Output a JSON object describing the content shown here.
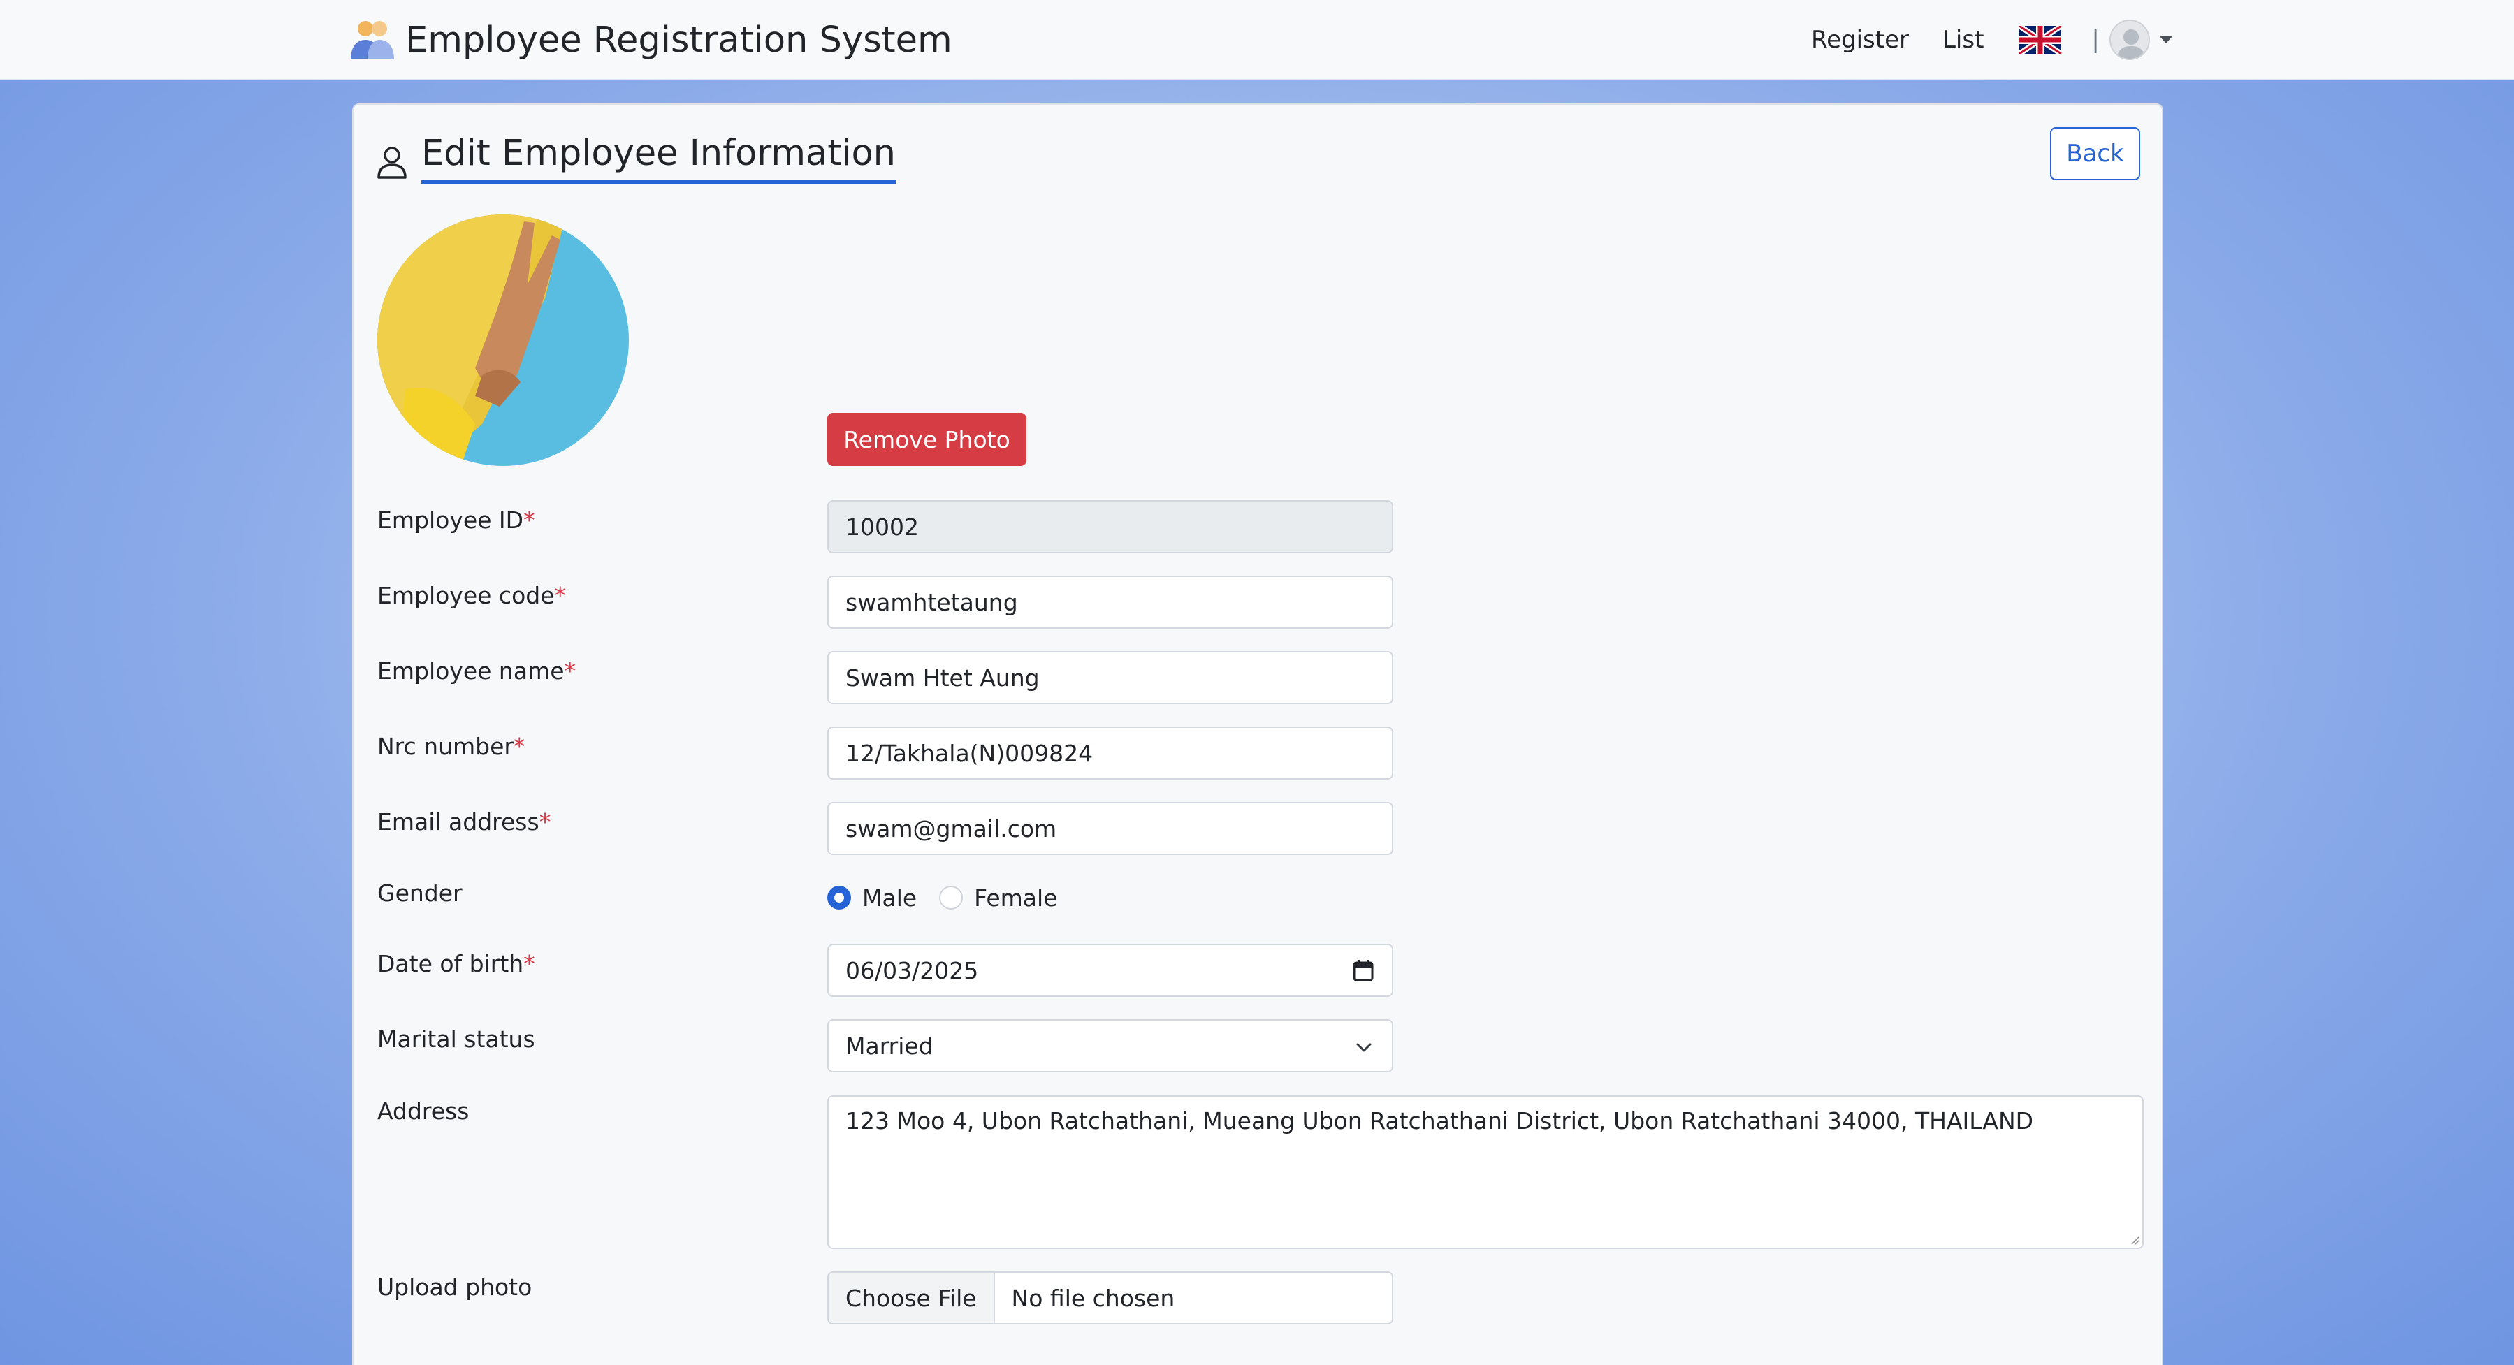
{
  "header": {
    "title": "Employee Registration System",
    "links": [
      "Register",
      "List"
    ],
    "separator": "|",
    "language_flag": "uk-flag-icon"
  },
  "page": {
    "title": "Edit Employee Information",
    "back_label": "Back",
    "remove_photo_label": "Remove Photo"
  },
  "form": {
    "required_mark": "*",
    "employee_id": {
      "label": "Employee ID",
      "value": "10002"
    },
    "employee_code": {
      "label": "Employee code",
      "value": "swamhtetaung"
    },
    "employee_name": {
      "label": "Employee name",
      "value": "Swam Htet Aung"
    },
    "nrc_number": {
      "label": "Nrc number",
      "value": "12/Takhala(N)009824"
    },
    "email": {
      "label": "Email address",
      "value": "swam@gmail.com"
    },
    "gender": {
      "label": "Gender",
      "options": [
        "Male",
        "Female"
      ],
      "selected": "Male"
    },
    "dob": {
      "label": "Date of birth",
      "value": "06/03/2025"
    },
    "marital_status": {
      "label": "Marital status",
      "value": "Married"
    },
    "address": {
      "label": "Address",
      "value": "123 Moo 4, Ubon Ratchathani, Mueang Ubon Ratchathani District, Ubon Ratchathani 34000, THAILAND"
    },
    "upload_photo": {
      "label": "Upload photo",
      "button": "Choose File",
      "status": "No file chosen"
    }
  },
  "colors": {
    "accent": "#2563d6",
    "danger": "#d63c43",
    "required": "#dc3545"
  }
}
